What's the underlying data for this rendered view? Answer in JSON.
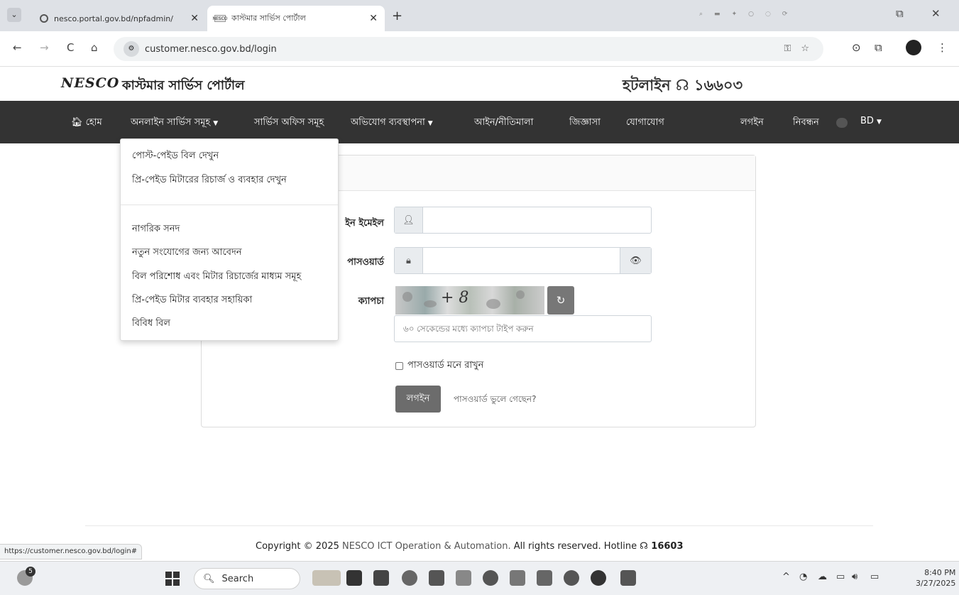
{
  "browser": {
    "tabs": [
      {
        "title": "nesco.portal.gov.bd/npfadmin/",
        "active": false
      },
      {
        "title": "কাস্টমার সার্ভিস পোর্টাল",
        "active": true
      }
    ],
    "url": "customer.nesco.gov.bd/login",
    "status_url": "https://customer.nesco.gov.bd/login#"
  },
  "header": {
    "logo": "NESCO",
    "portal_title": "কাস্টমার সার্ভিস পোর্টাল",
    "hotline": "হটলাইন ☊ ১৬৬০৩"
  },
  "nav": {
    "home": "হোম",
    "online_services": "অনলাইন সার্ভিস সমূহ",
    "service_offices": "সার্ভিস অফিস সমূহ",
    "complaint": "অভিযোগ ব্যবস্থাপনা",
    "law": "আইন/নীতিমালা",
    "faq": "জিজ্ঞাসা",
    "contact": "যোগাযোগ",
    "login": "লগইন",
    "register": "নিবন্ধন",
    "lang": "BD"
  },
  "dropdown": {
    "items": [
      "পোস্ট-পেইড বিল দেখুন",
      "প্রি-পেইড মিটারের রিচার্জ ও ব্যবহার দেখুন",
      "নাগরিক সনদ",
      "নতুন সংযোগের জন্য আবেদন",
      "বিল পরিশোধ এবং মিটার রিচার্জের মাধ্যম সমূহ",
      "প্রি-পেইড মিটার ব্যবহার সহায়িকা",
      "বিবিধ বিল"
    ]
  },
  "form": {
    "email_label": "ইন ইমেইল",
    "password_label": "পাসওয়ার্ড",
    "captcha_label": "ক্যাপচা",
    "captcha_text": "+ 8",
    "captcha_placeholder": "৬০ সেকেন্ডের মধ্যে ক্যাপচা টাইপ করুন",
    "remember": "পাসওয়ার্ড মনে রাখুন",
    "login_button": "লগইন",
    "forgot": "পাসওয়ার্ড ভুলে গেছেন?"
  },
  "footer": {
    "prefix": "Copyright © 2025 ",
    "org": "NESCO ICT Operation & Automation.",
    "suffix": " All rights reserved. Hotline ",
    "hotline": "☊ 16603"
  },
  "taskbar": {
    "search": "Search",
    "time": "8:40 PM",
    "date": "3/27/2025",
    "weather_badge": "5"
  }
}
